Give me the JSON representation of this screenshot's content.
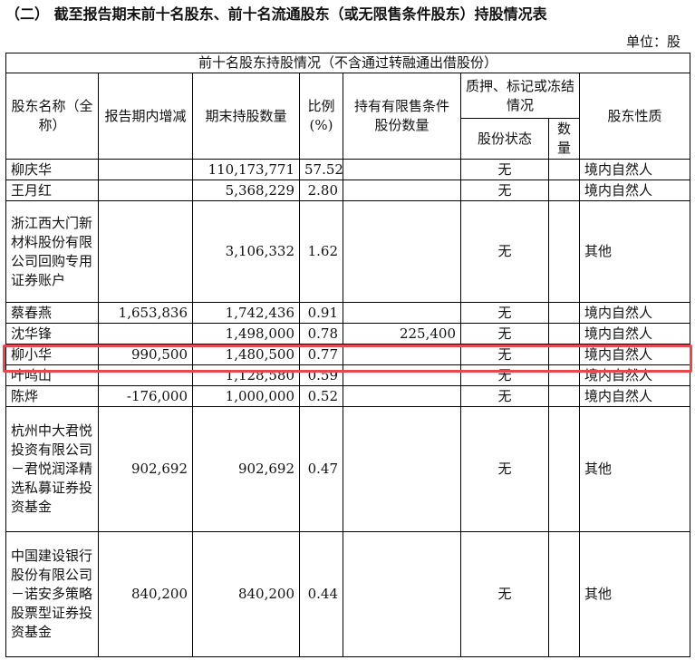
{
  "title": "（二）  截至报告期末前十名股东、前十名流通股东（或无限售条件股东）持股情况表",
  "unit": "单位：股",
  "table": {
    "caption": "前十名股东持股情况（不含通过转融通出借股份）",
    "headers": {
      "name": "股东名称（全称）",
      "change": "报告期内增减",
      "shares": "期末持股数量",
      "ratio": "比例(%)",
      "restricted": "持有有限售条件股份数量",
      "pledge": "质押、标记或冻结情况",
      "pledge_status": "股份状态",
      "pledge_qty": "数量",
      "nature": "股东性质"
    },
    "rows": [
      {
        "name": "柳庆华",
        "change": "",
        "shares": "110,173,771",
        "ratio": "57.52",
        "restricted": "",
        "status": "无",
        "qty": "",
        "nature": "境内自然人"
      },
      {
        "name": "王月红",
        "change": "",
        "shares": "5,368,229",
        "ratio": "2.80",
        "restricted": "",
        "status": "无",
        "qty": "",
        "nature": "境内自然人"
      },
      {
        "name": "浙江西大门新材料股份有限公司回购专用证券账户",
        "change": "",
        "shares": "3,106,332",
        "ratio": "1.62",
        "restricted": "",
        "status": "无",
        "qty": "",
        "nature": "其他"
      },
      {
        "name": "蔡春燕",
        "change": "1,653,836",
        "shares": "1,742,436",
        "ratio": "0.91",
        "restricted": "",
        "status": "无",
        "qty": "",
        "nature": "境内自然人"
      },
      {
        "name": "沈华锋",
        "change": "",
        "shares": "1,498,000",
        "ratio": "0.78",
        "restricted": "225,400",
        "status": "无",
        "qty": "",
        "nature": "境内自然人"
      },
      {
        "name": "柳小华",
        "change": "990,500",
        "shares": "1,480,500",
        "ratio": "0.77",
        "restricted": "",
        "status": "无",
        "qty": "",
        "nature": "境内自然人"
      },
      {
        "name": "叶鸣山",
        "change": "",
        "shares": "1,128,580",
        "ratio": "0.59",
        "restricted": "",
        "status": "无",
        "qty": "",
        "nature": "境内自然人"
      },
      {
        "name": "陈烨",
        "change": "-176,000",
        "shares": "1,000,000",
        "ratio": "0.52",
        "restricted": "",
        "status": "无",
        "qty": "",
        "nature": "境内自然人"
      },
      {
        "name": "杭州中大君悦投资有限公司－君悦润泽精选私募证券投资基金",
        "change": "902,692",
        "shares": "902,692",
        "ratio": "0.47",
        "restricted": "",
        "status": "无",
        "qty": "",
        "nature": "其他"
      },
      {
        "name": "中国建设银行股份有限公司－诺安多策略股票型证券投资基金",
        "change": "840,200",
        "shares": "840,200",
        "ratio": "0.44",
        "restricted": "",
        "status": "无",
        "qty": "",
        "nature": "其他"
      }
    ]
  },
  "colors": {
    "highlight": "#e8474f"
  }
}
